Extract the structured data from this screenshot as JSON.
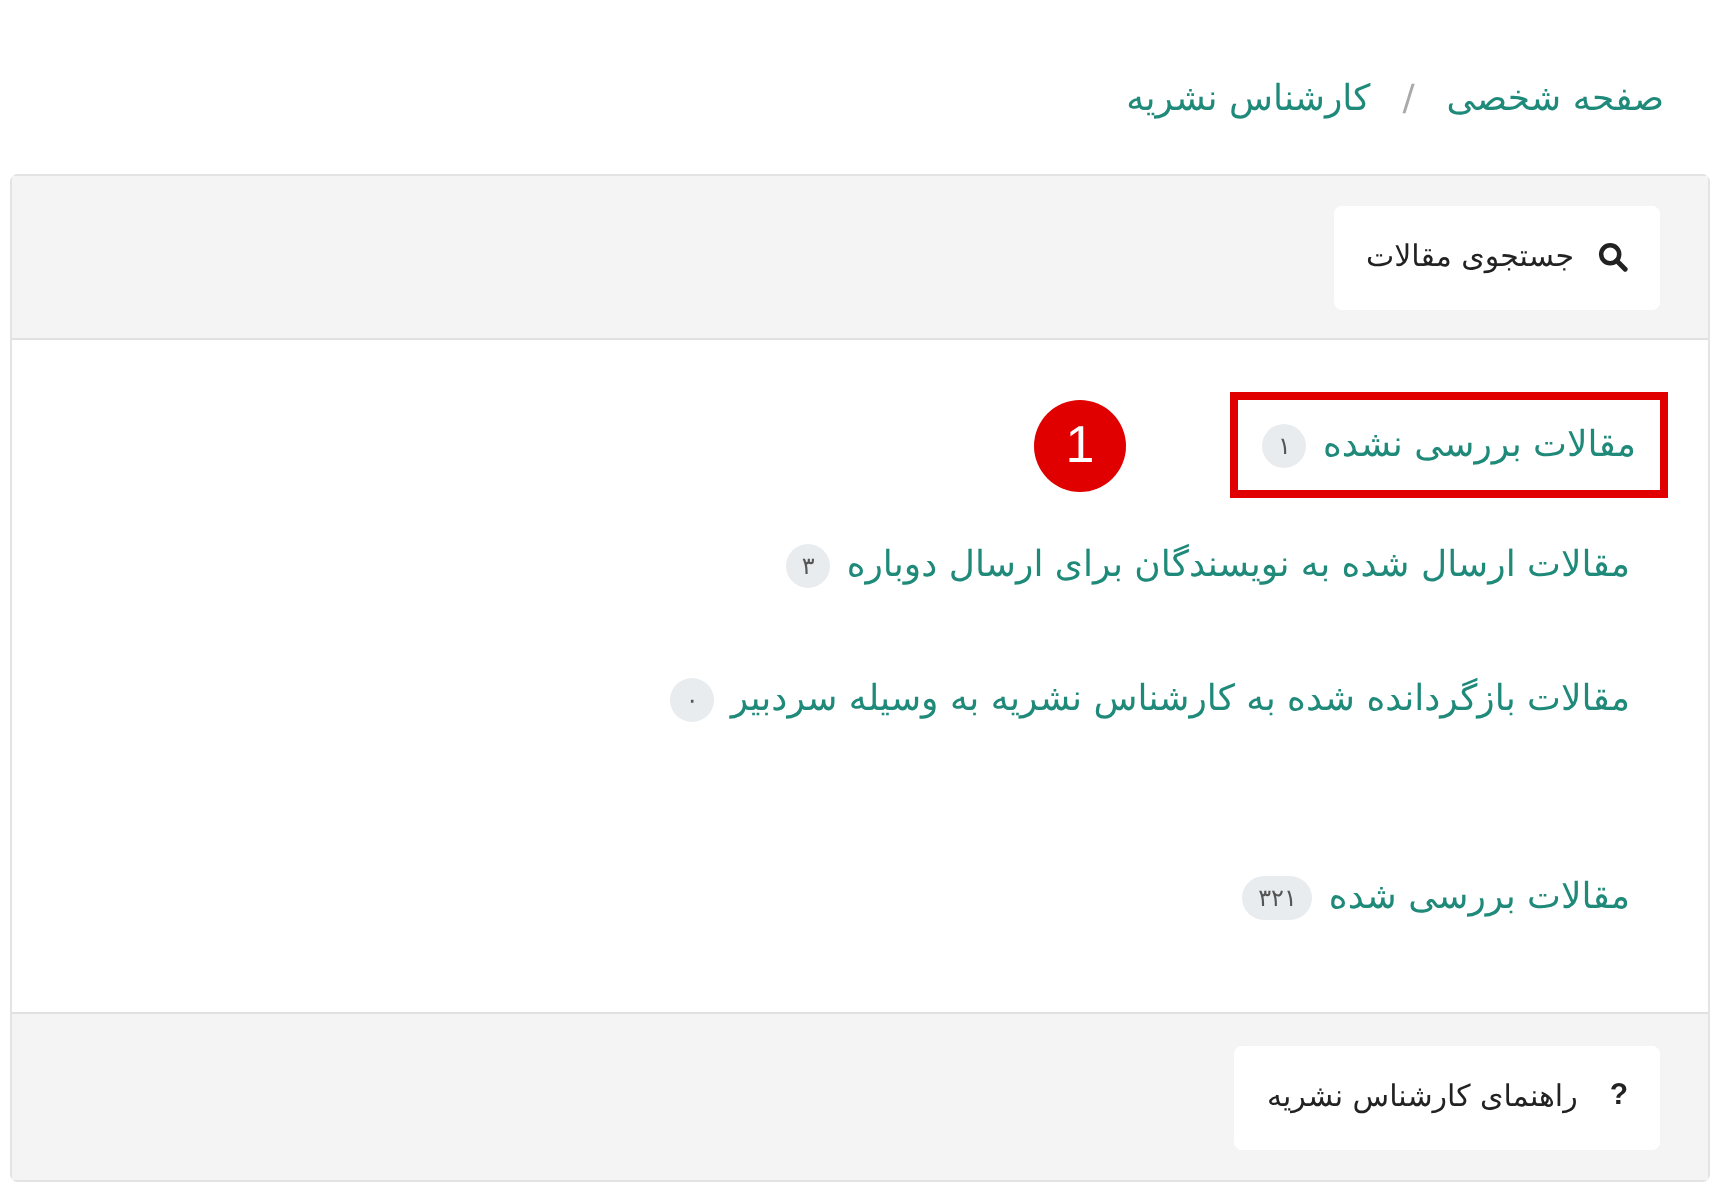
{
  "breadcrumb": [
    "صفحه شخصی",
    "کارشناس نشریه"
  ],
  "breadcrumb_separator": "/",
  "search_button": {
    "label": "جستجوی مقالات"
  },
  "article_links": [
    {
      "label": "مقالات بررسی نشده",
      "count": "۱",
      "highlighted": true,
      "callout": "1"
    },
    {
      "label": "مقالات ارسال شده به نویسندگان برای ارسال دوباره",
      "count": "۳",
      "highlighted": false
    },
    {
      "label": "مقالات بازگردانده شده به کارشناس نشریه به وسیله سردبیر",
      "count": "۰",
      "highlighted": false
    },
    {
      "label": "مقالات بررسی شده",
      "count": "۳۲۱",
      "highlighted": false
    }
  ],
  "help_button": {
    "icon": "?",
    "label": "راهنمای کارشناس نشریه"
  }
}
